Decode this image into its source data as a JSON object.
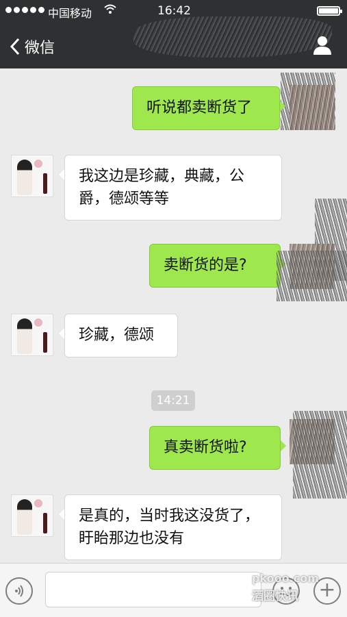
{
  "status_bar": {
    "carrier": "中国移动",
    "time": "16:42"
  },
  "nav": {
    "back_label": "微信"
  },
  "messages": [
    {
      "side": "right",
      "text": "听说都卖断货了"
    },
    {
      "side": "left",
      "text": "我这边是珍藏，典藏，公爵，德颂等等"
    },
    {
      "side": "right",
      "text": "卖断货的是?"
    },
    {
      "side": "left",
      "text": "珍藏，德颂"
    },
    {
      "side": "right",
      "text": "真卖断货啦?"
    },
    {
      "side": "left",
      "text": "是真的，当时我这没货了，盱眙那边也没有"
    }
  ],
  "timestamp": "14:21",
  "input_bar": {
    "value": ""
  },
  "watermark": {
    "line1": "pkooo.com",
    "line2": "酒圈快讯"
  },
  "icons": [
    "signal-dots",
    "wifi",
    "battery",
    "chevron-left",
    "profile",
    "voice",
    "emoji",
    "plus"
  ],
  "colors": {
    "nav_bg": "#2e3132",
    "chat_bg": "#ebebeb",
    "bubble_self": "#9ee84d",
    "bubble_other": "#ffffff"
  }
}
